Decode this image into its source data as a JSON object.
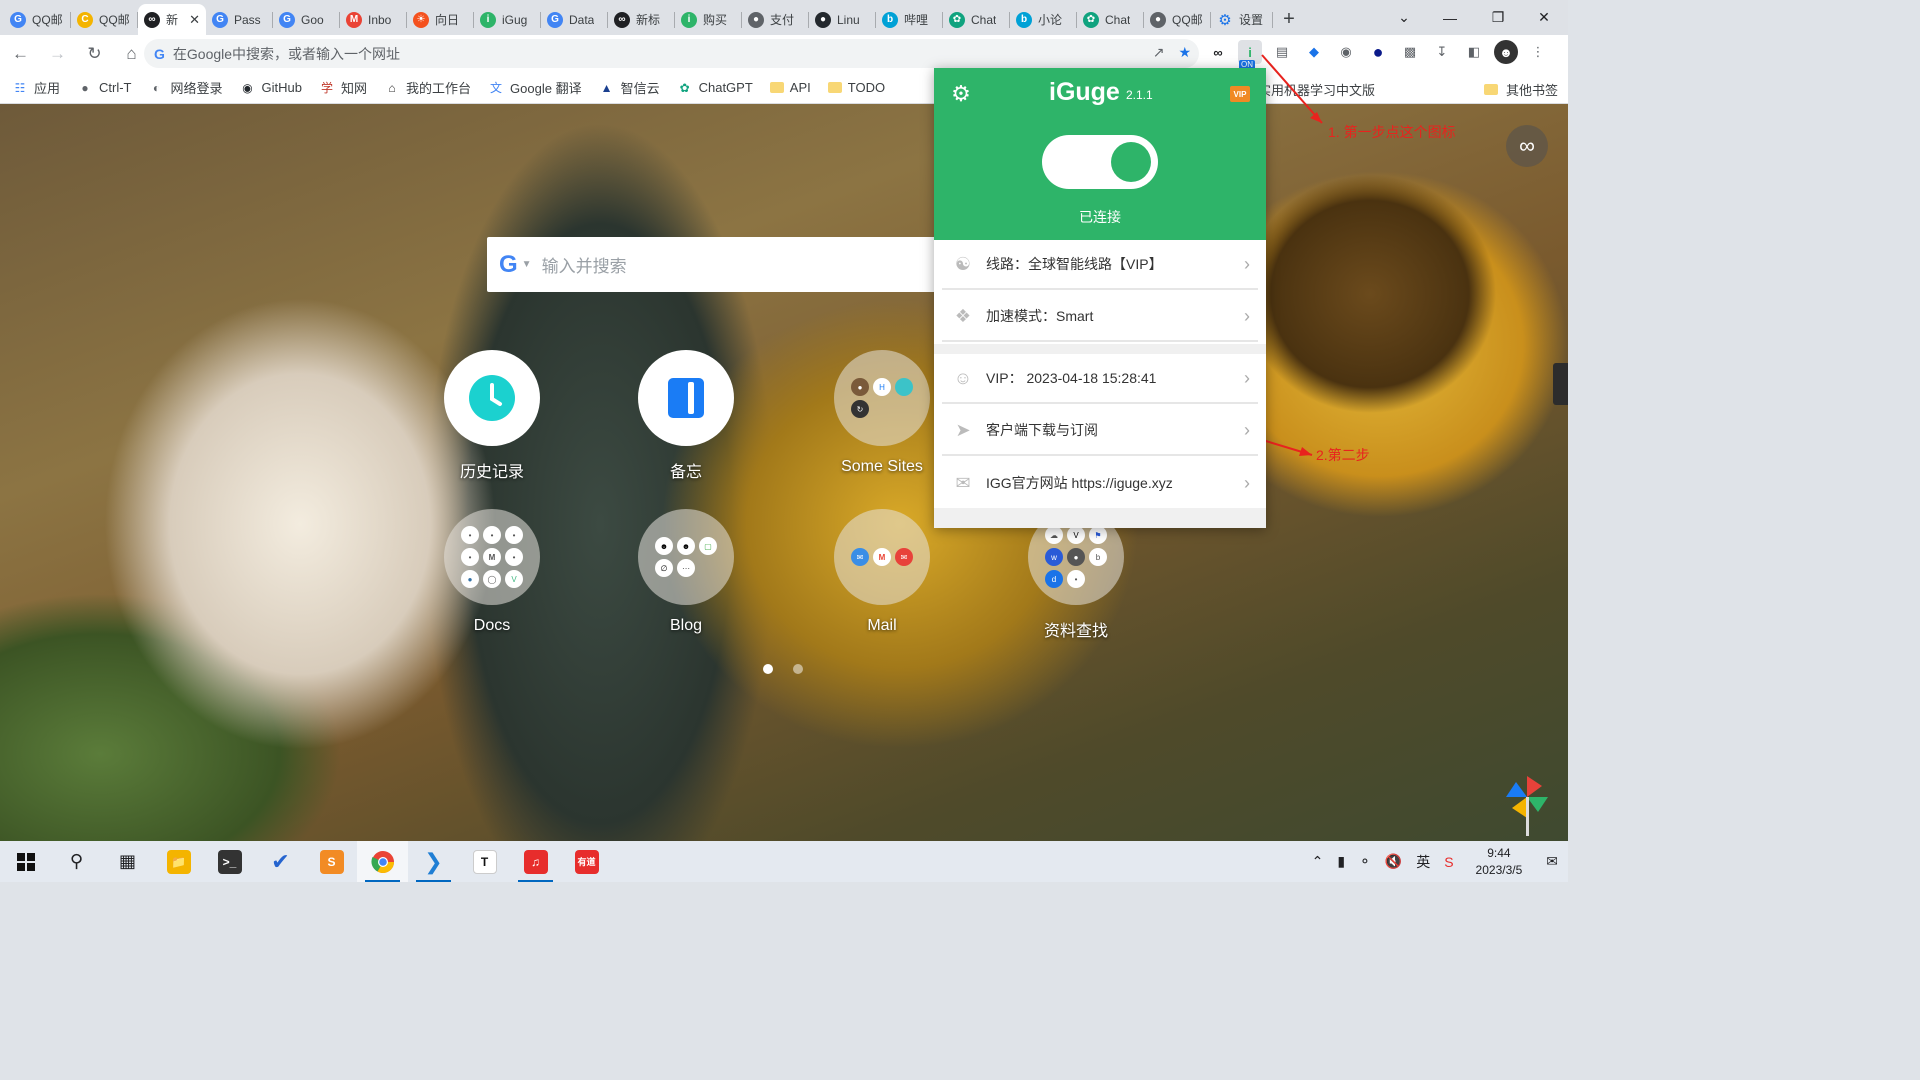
{
  "tabs": [
    {
      "title": "QQ邮",
      "favicon": "G",
      "color": "#4285f4"
    },
    {
      "title": "QQ邮",
      "favicon": "C",
      "color": "#f4b400"
    },
    {
      "title": "新",
      "favicon": "∞",
      "color": "#202124",
      "active": true
    },
    {
      "title": "Pass",
      "favicon": "G",
      "color": "#4285f4"
    },
    {
      "title": "Goo",
      "favicon": "G",
      "color": "#4285f4"
    },
    {
      "title": "Inbo",
      "favicon": "M",
      "color": "#ea4335"
    },
    {
      "title": "向日",
      "favicon": "☀",
      "color": "#f4511e"
    },
    {
      "title": "iGug",
      "favicon": "i",
      "color": "#2eb469"
    },
    {
      "title": "Data",
      "favicon": "G",
      "color": "#4285f4"
    },
    {
      "title": "新标",
      "favicon": "∞",
      "color": "#202124"
    },
    {
      "title": "购买",
      "favicon": "i",
      "color": "#2eb469"
    },
    {
      "title": "支付",
      "favicon": "●",
      "color": "#5f6368"
    },
    {
      "title": "Linu",
      "favicon": "●",
      "color": "#24292e"
    },
    {
      "title": "哔哩",
      "favicon": "b",
      "color": "#00a1d6"
    },
    {
      "title": "Chat",
      "favicon": "✿",
      "color": "#10a37f"
    },
    {
      "title": "小论",
      "favicon": "b",
      "color": "#00a1d6"
    },
    {
      "title": "Chat",
      "favicon": "✿",
      "color": "#10a37f"
    },
    {
      "title": "QQ邮",
      "favicon": "●",
      "color": "#5f6368"
    }
  ],
  "settings_tab": {
    "title": "设置",
    "favicon": "⚙"
  },
  "omnibox": {
    "placeholder": "在Google中搜索，或者输入一个网址"
  },
  "extension_badge": "ON",
  "bookmarks": [
    {
      "label": "应用",
      "icon": "apps-grid-icon"
    },
    {
      "label": "Ctrl-T",
      "icon": "circle-icon"
    },
    {
      "label": "网络登录",
      "icon": "globe-icon"
    },
    {
      "label": "GitHub",
      "icon": "github-icon"
    },
    {
      "label": "知网",
      "icon": "cnki-icon"
    },
    {
      "label": "我的工作台",
      "icon": "workbench-icon"
    },
    {
      "label": "Google 翻译",
      "icon": "translate-icon"
    },
    {
      "label": "智信云",
      "icon": "cloud-icon"
    },
    {
      "label": "ChatGPT",
      "icon": "openai-icon"
    },
    {
      "label": "API",
      "icon": "folder-icon"
    },
    {
      "label": "TODO",
      "icon": "folder-icon"
    }
  ],
  "bookmark_mid": "实用机器学习中文版",
  "bookmark_other": "其他书签",
  "newtab": {
    "search_placeholder": "输入并搜索",
    "tiles": [
      {
        "label": "历史记录",
        "icon": "clock-icon"
      },
      {
        "label": "备忘",
        "icon": "memo-icon"
      },
      {
        "label": "Some Sites",
        "icon": "folder-grid-icon"
      },
      {
        "label": "Docs",
        "icon": "folder-grid-icon"
      },
      {
        "label": "Blog",
        "icon": "folder-grid-icon"
      },
      {
        "label": "Mail",
        "icon": "folder-grid-icon"
      },
      {
        "label": "资料查找",
        "icon": "folder-grid-icon"
      }
    ],
    "page_count": 2,
    "active_page": 1
  },
  "annotations": {
    "step1": "1. 第一步点这个图标",
    "step2": "2.第二步"
  },
  "iguge": {
    "title": "iGuge",
    "version": "2.1.1",
    "vip_badge": "VIP",
    "connected": true,
    "status": "已连接",
    "rows": [
      {
        "label": "线路：全球智能线路【VIP】",
        "icon": "globe-icon"
      },
      {
        "label": "加速模式：Smart",
        "icon": "diamond-icon"
      },
      {
        "label": "VIP： 2023-04-18 15:28:41",
        "icon": "user-icon"
      },
      {
        "label": "客户端下载与订阅",
        "icon": "paper-plane-icon"
      },
      {
        "label": "IGG官方网站 https://iguge.xyz",
        "icon": "message-icon"
      }
    ]
  },
  "taskbar": {
    "apps": [
      "start-icon",
      "search-icon",
      "task-view-icon",
      "file-explorer-icon",
      "terminal-icon",
      "todo-icon",
      "sublime-icon",
      "chrome-icon",
      "vscode-icon",
      "typora-icon",
      "netease-music-icon",
      "youdao-icon"
    ],
    "time": "9:44",
    "date": "2023/3/5"
  },
  "colors": {
    "brand": "#2eb469",
    "annotation": "#e8231e"
  }
}
